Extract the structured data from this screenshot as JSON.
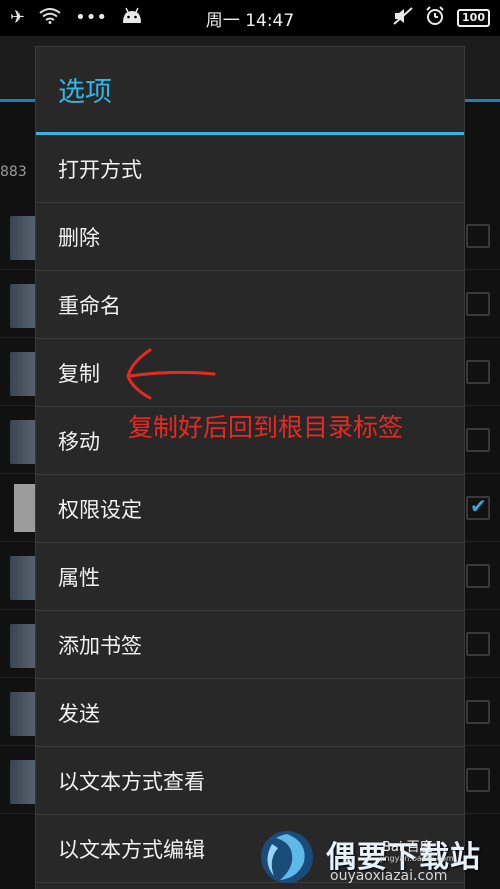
{
  "status_bar": {
    "time": "周一 14:47",
    "battery": "100",
    "icons": [
      "airplane-icon",
      "wifi-icon",
      "more-dots-icon",
      "android-icon",
      "mute-icon",
      "alarm-icon",
      "battery-icon"
    ]
  },
  "background": {
    "path_fragment": "883"
  },
  "dialog": {
    "title": "选项",
    "items": [
      "打开方式",
      "删除",
      "重命名",
      "复制",
      "移动",
      "权限设定",
      "属性",
      "添加书签",
      "发送",
      "以文本方式查看",
      "以文本方式编辑"
    ]
  },
  "annotation": {
    "text": "复制好后回到根目录标签",
    "color": "#e62a23"
  },
  "watermark": {
    "brand": "偶要下载站",
    "url": "ouyaoxiazai.com",
    "baidu": "Bai 百度",
    "baidu_sub": "jingyan.baidu.com"
  },
  "colors": {
    "accent": "#33b5e5",
    "dialog_bg": "#282828"
  }
}
